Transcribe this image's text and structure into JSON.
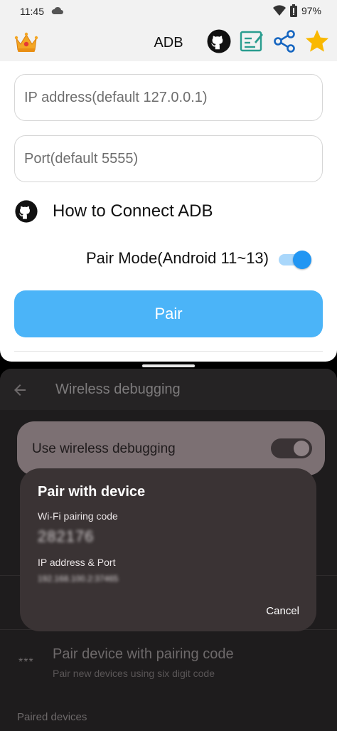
{
  "status_bar": {
    "time": "11:45",
    "battery": "97%"
  },
  "app_bar": {
    "title": "ADB",
    "icons": [
      "crown-icon",
      "github-icon",
      "edit-note-icon",
      "share-icon",
      "star-icon"
    ]
  },
  "form": {
    "ip_placeholder": "IP address(default 127.0.0.1)",
    "port_placeholder": "Port(default 5555)",
    "how_to_label": "How to Connect ADB",
    "pair_mode_label": "Pair Mode(Android 11~13)",
    "pair_mode_on": true,
    "pair_button": "Pair"
  },
  "settings": {
    "title": "Wireless debugging",
    "use_wireless_label": "Use wireless debugging",
    "pair_code_title": "Pair device with pairing code",
    "pair_code_subtitle": "Pair new devices using six digit code",
    "paired_devices_header": "Paired devices"
  },
  "dialog": {
    "title": "Pair with device",
    "code_label": "Wi-Fi pairing code",
    "code_value": "282176",
    "ip_label": "IP address & Port",
    "ip_value": "192.168.100.2:37465",
    "cancel": "Cancel"
  },
  "colors": {
    "accent_blue": "#4bb4f8",
    "toggle_blue": "#2196f3",
    "dialog_bg": "#3a3334",
    "settings_bg": "#1e1c1d"
  }
}
